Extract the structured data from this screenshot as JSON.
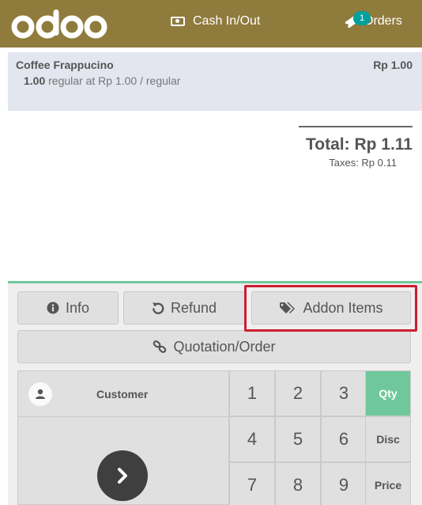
{
  "header": {
    "logo_text": "odoo",
    "cash_label": "Cash In/Out",
    "orders_label": "Orders",
    "orders_count": "1"
  },
  "orderline": {
    "product": "Coffee Frappucino",
    "price": "Rp 1.00",
    "qty": "1.00",
    "detail": "regular at Rp 1.00 / regular"
  },
  "summary": {
    "total": "Total: Rp 1.11",
    "taxes": "Taxes: Rp 0.11"
  },
  "controls": {
    "info": "Info",
    "refund": "Refund",
    "addon": "Addon Items",
    "quotation": "Quotation/Order"
  },
  "actionpad": {
    "customer": "Customer"
  },
  "numpad": {
    "k1": "1",
    "k2": "2",
    "k3": "3",
    "k4": "4",
    "k5": "5",
    "k6": "6",
    "k7": "7",
    "k8": "8",
    "k9": "9",
    "qty": "Qty",
    "disc": "Disc",
    "price": "Price"
  },
  "colors": {
    "header": "#8f7b3c",
    "accent": "#6ec89b",
    "badge": "#00a09d",
    "highlight": "#cc1f2d"
  }
}
